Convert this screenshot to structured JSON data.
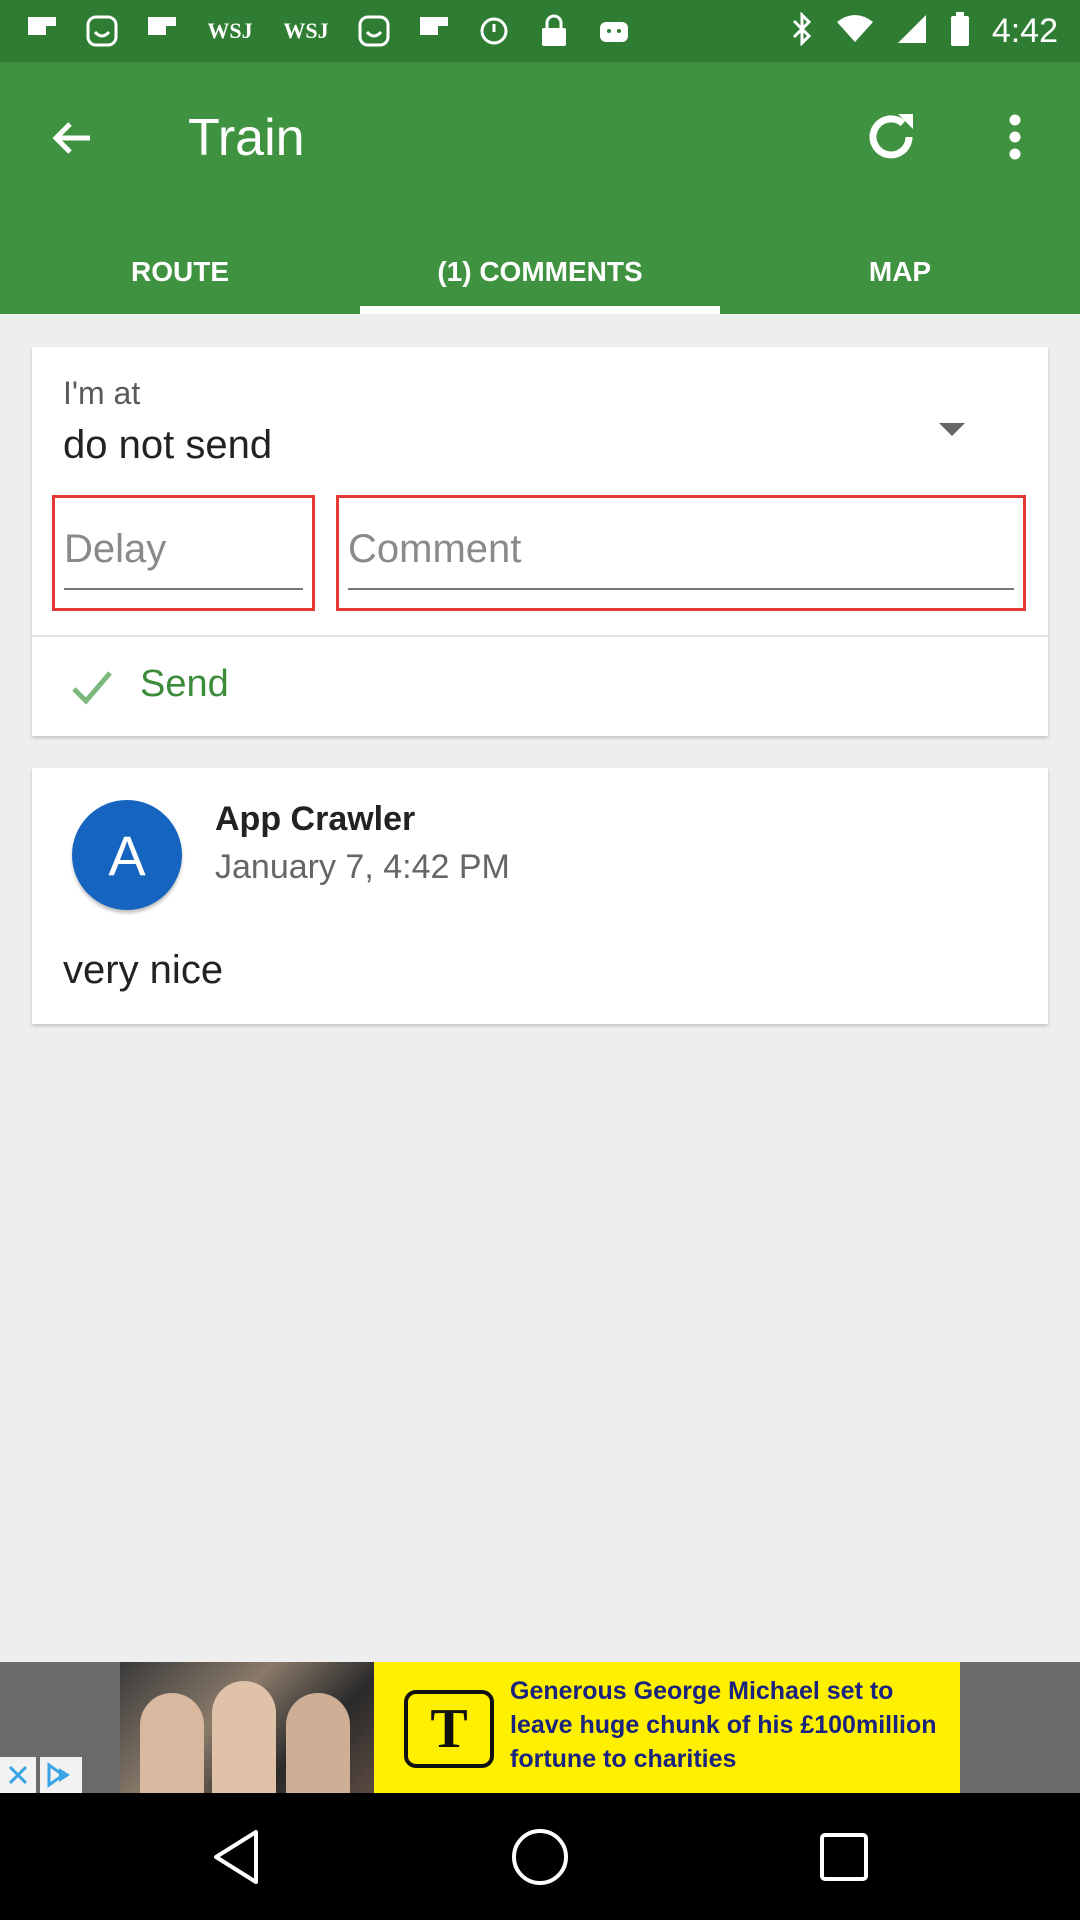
{
  "status_bar": {
    "time": "4:42",
    "left_icons": [
      "flipboard-icon",
      "smiley-icon",
      "flipboard-icon",
      "wsj-icon",
      "wsj-icon",
      "smiley-icon",
      "flipboard-icon",
      "alarm-icon",
      "lock-icon",
      "android-icon"
    ],
    "wsj_text": "WSJ",
    "right_icons": [
      "bluetooth-icon",
      "wifi-icon",
      "signal-icon",
      "battery-icon"
    ]
  },
  "app_bar": {
    "title": "Train",
    "back_icon": "back-arrow-icon",
    "refresh_icon": "refresh-icon",
    "more_icon": "more-vert-icon",
    "color": "#3f923f"
  },
  "tabs": [
    {
      "label": "ROUTE",
      "active": false
    },
    {
      "label": "(1) COMMENTS",
      "active": true
    },
    {
      "label": "MAP",
      "active": false
    }
  ],
  "form": {
    "spinner_label": "I'm at",
    "spinner_value": "do not send",
    "delay_placeholder": "Delay",
    "comment_placeholder": "Comment",
    "send_label": "Send",
    "send_color": "#3c8c3c"
  },
  "comments": [
    {
      "avatar_letter": "A",
      "author": "App Crawler",
      "timestamp": "January 7, 4:42 PM",
      "text": "very nice",
      "avatar_color": "#1565c0"
    }
  ],
  "ad": {
    "logo_letter": "T",
    "headline": "Generous George Michael set to leave huge chunk of his £100million fortune to charities",
    "background": "#fff000"
  },
  "nav_bar": {
    "buttons": [
      "back-triangle-icon",
      "home-circle-icon",
      "recents-square-icon"
    ]
  }
}
